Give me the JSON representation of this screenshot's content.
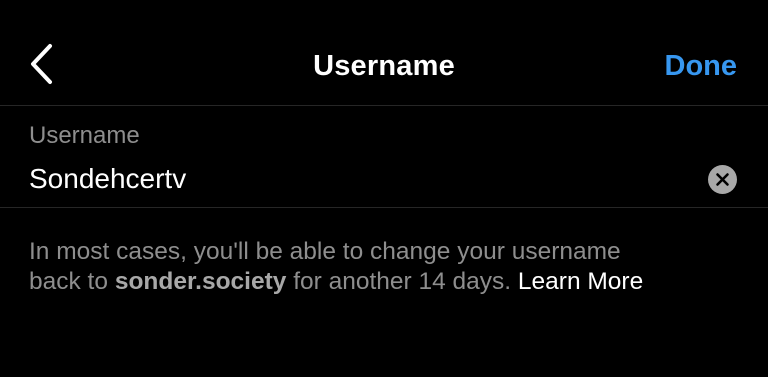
{
  "header": {
    "title": "Username",
    "done_label": "Done",
    "back_icon": "chevron-left-icon"
  },
  "field": {
    "label": "Username",
    "value": "Sondehcertv",
    "clear_icon": "clear-circle-x-icon"
  },
  "helper": {
    "line1": "In most cases, you'll be able to change your username",
    "prefix": "back to ",
    "old_username": "sonder.society",
    "suffix": " for another 14 days. ",
    "learn_more": "Learn More"
  },
  "colors": {
    "background": "#000000",
    "accent": "#3797f0",
    "secondary_text": "#8e8e8e",
    "divider": "#262626"
  }
}
